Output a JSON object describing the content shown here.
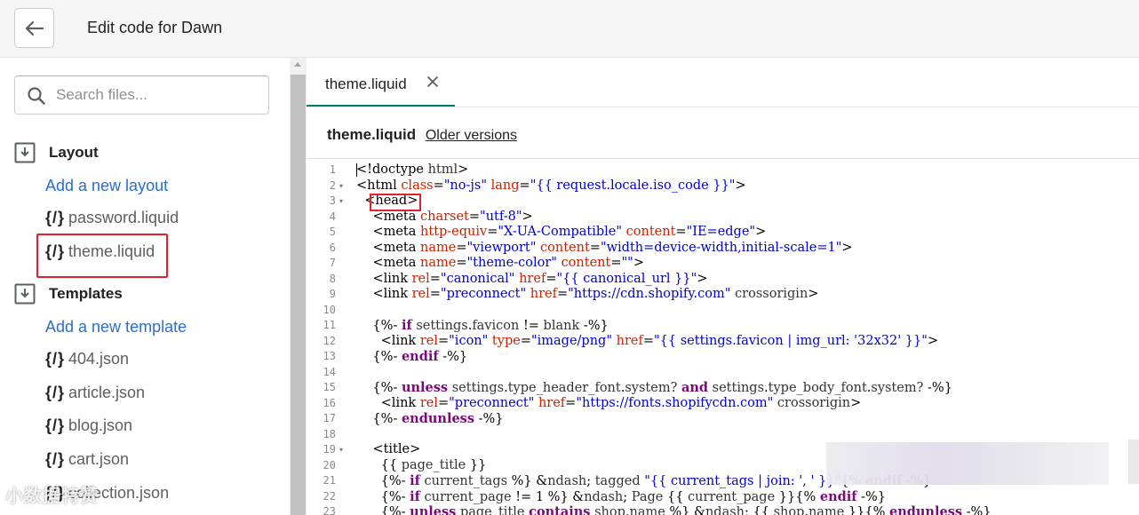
{
  "header": {
    "title": "Edit code for Dawn"
  },
  "sidebar": {
    "search_placeholder": "Search files...",
    "sections": [
      {
        "label": "Layout",
        "add_label": "Add a new layout",
        "files": [
          "password.liquid",
          "theme.liquid"
        ]
      },
      {
        "label": "Templates",
        "add_label": "Add a new template",
        "files": [
          "404.json",
          "article.json",
          "blog.json",
          "cart.json",
          "collection.json"
        ]
      }
    ],
    "file_glyph": "{/}"
  },
  "editor": {
    "tab_label": "theme.liquid",
    "file_name": "theme.liquid",
    "older_versions": "Older versions",
    "lines": [
      "<!doctype html>",
      "<html class=\"no-js\" lang=\"{{ request.locale.iso_code }}\">",
      "  <head>",
      "    <meta charset=\"utf-8\">",
      "    <meta http-equiv=\"X-UA-Compatible\" content=\"IE=edge\">",
      "    <meta name=\"viewport\" content=\"width=device-width,initial-scale=1\">",
      "    <meta name=\"theme-color\" content=\"\">",
      "    <link rel=\"canonical\" href=\"{{ canonical_url }}\">",
      "    <link rel=\"preconnect\" href=\"https://cdn.shopify.com\" crossorigin>",
      "",
      "    {%- if settings.favicon != blank -%}",
      "      <link rel=\"icon\" type=\"image/png\" href=\"{{ settings.favicon | img_url: '32x32' }}\">",
      "    {%- endif -%}",
      "",
      "    {%- unless settings.type_header_font.system? and settings.type_body_font.system? -%}",
      "      <link rel=\"preconnect\" href=\"https://fonts.shopifycdn.com\" crossorigin>",
      "    {%- endunless -%}",
      "",
      "    <title>",
      "      {{ page_title }}",
      "      {%- if current_tags %} &ndash; tagged \"{{ current_tags | join: ', ' }}\"{% endif -%}",
      "      {%- if current_page != 1 %} &ndash; Page {{ current_page }}{% endif -%}",
      "      {%- unless page_title contains shop.name %} &ndash; {{ shop.name }}{% endunless -%}"
    ],
    "line_numbers": [
      "1",
      "2",
      "3",
      "4",
      "5",
      "6",
      "7",
      "8",
      "9",
      "10",
      "11",
      "12",
      "13",
      "14",
      "15",
      "16",
      "17",
      "18",
      "19",
      "20",
      "21",
      "22",
      "23"
    ],
    "fold_lines": [
      "2",
      "3",
      "19"
    ]
  },
  "watermark": "小数据特赞"
}
